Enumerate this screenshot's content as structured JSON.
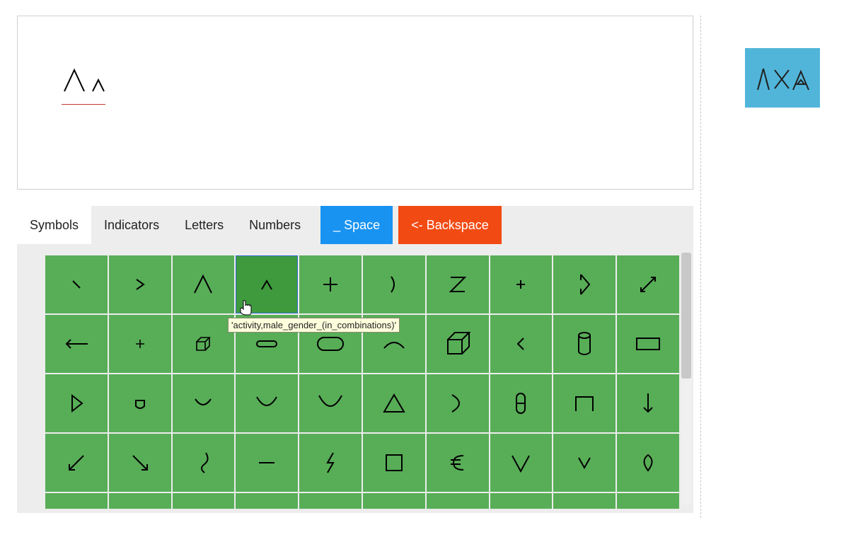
{
  "tabs": {
    "symbols": "Symbols",
    "indicators": "Indicators",
    "letters": "Letters",
    "numbers": "Numbers",
    "space": "_ Space",
    "backspace": "<- Backspace"
  },
  "tooltip": "'activity,male_gender_(in_combinations)'",
  "chart_data": null,
  "symbol_keys": [
    [
      "grave",
      "rangle",
      "caret-large",
      "caret-small",
      "plus",
      "rparen",
      "z-sign",
      "plus-small",
      "rangle-2",
      "arrow-diag-both"
    ],
    [
      "arrow-left",
      "plus-tiny",
      "cube-small",
      "pill",
      "round-rect",
      "arc",
      "cube-large",
      "langle",
      "cylinder",
      "rect"
    ],
    [
      "triangle-right",
      "teardrop",
      "cup-small",
      "cup-med",
      "cup-large",
      "triangle",
      "half-circle",
      "capsule",
      "bracket",
      "arrow-down"
    ],
    [
      "arrow-sw",
      "arrow-se",
      "hook",
      "underscore",
      "lightning",
      "square",
      "euro",
      "vee-large",
      "vee-small",
      "diamond"
    ]
  ]
}
